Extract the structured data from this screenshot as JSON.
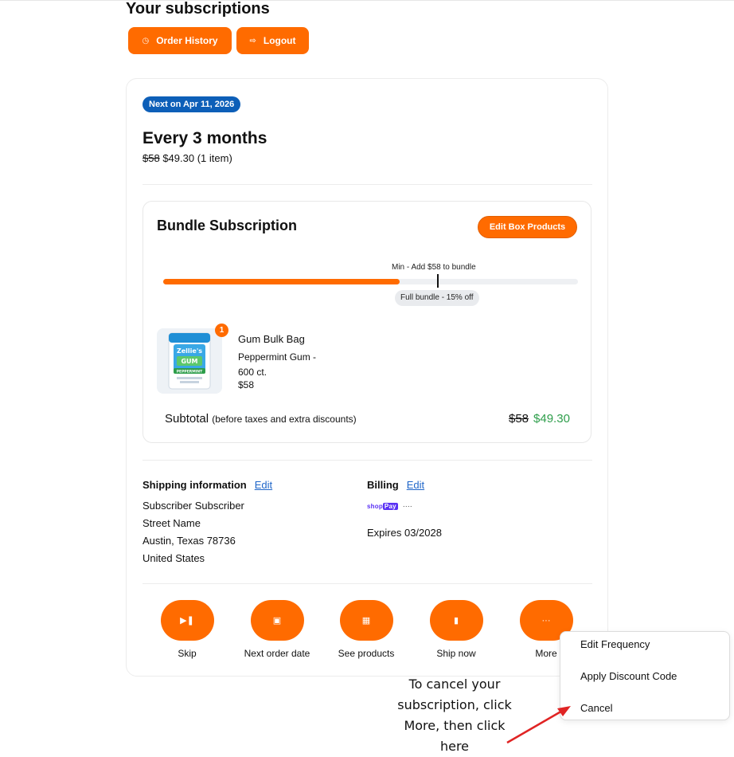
{
  "header": {
    "title": "Your subscriptions",
    "order_history_label": "Order History",
    "logout_label": "Logout"
  },
  "subscription": {
    "next_badge": "Next on Apr 11, 2026",
    "frequency": "Every 3 months",
    "price_old": "$58",
    "price_new": "$49.30",
    "item_count": "(1 item)"
  },
  "bundle": {
    "title": "Bundle Subscription",
    "edit_button": "Edit Box Products",
    "min_label": "Min - Add $58 to bundle",
    "full_bundle_label": "Full bundle - 15% off",
    "progress_fraction": 0.57,
    "product": {
      "quantity": "1",
      "name": "Gum Bulk Bag",
      "variant": "Peppermint Gum - 600 ct.",
      "price": "$58",
      "image_text_top": "Zellie's",
      "image_text_mid": "GUM",
      "image_text_bottom": "PEPPERMINT"
    },
    "subtotal_label": "Subtotal",
    "subtotal_note": "(before taxes and extra discounts)",
    "subtotal_old": "$58",
    "subtotal_new": "$49.30"
  },
  "shipping": {
    "heading": "Shipping information",
    "edit_label": "Edit",
    "name": "Subscriber Subscriber",
    "street": "Street Name",
    "city_line": "Austin, Texas 78736",
    "country": "United States"
  },
  "billing": {
    "heading": "Billing",
    "edit_label": "Edit",
    "method_logo_text": "shop",
    "method_logo_badge": "Pay",
    "masked": "····",
    "expires": "Expires 03/2028"
  },
  "actions": [
    {
      "label": "Skip",
      "icon": "skip-icon"
    },
    {
      "label": "Next order date",
      "icon": "calendar-icon"
    },
    {
      "label": "See products",
      "icon": "grid-icon"
    },
    {
      "label": "Ship now",
      "icon": "bag-icon"
    },
    {
      "label": "More",
      "icon": "more-icon"
    }
  ],
  "more_menu": {
    "items": [
      "Edit Frequency",
      "Apply Discount Code",
      "Cancel"
    ]
  },
  "annotation": {
    "text": "To cancel your subscription, click More, then click here",
    "arrow_color": "#e02424"
  },
  "colors": {
    "accent": "#ff6b00",
    "badge_blue": "#0d5fb8",
    "discount_green": "#2e9e4b",
    "link_blue": "#1f66c9"
  }
}
